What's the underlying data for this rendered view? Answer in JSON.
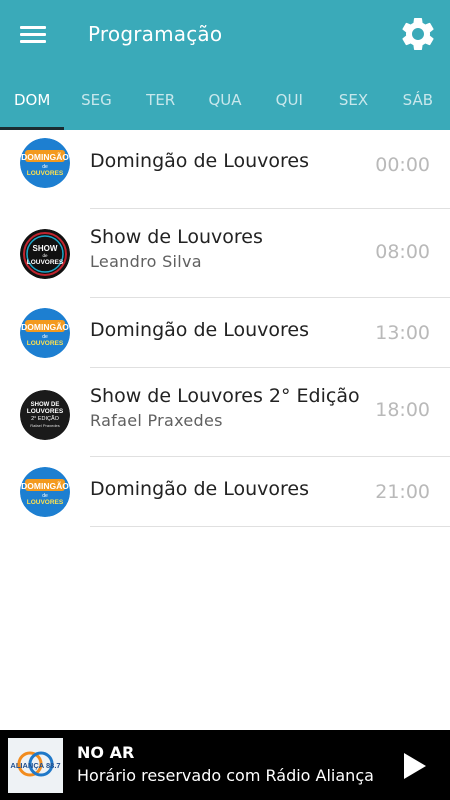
{
  "header": {
    "title": "Programação",
    "menu_icon": "hamburger-menu-icon",
    "settings_icon": "gear-icon",
    "bg_color": "#3aaab9"
  },
  "tabs": [
    {
      "label": "DOM",
      "active": true
    },
    {
      "label": "SEG",
      "active": false
    },
    {
      "label": "TER",
      "active": false
    },
    {
      "label": "QUA",
      "active": false
    },
    {
      "label": "QUI",
      "active": false
    },
    {
      "label": "SEX",
      "active": false
    },
    {
      "label": "SÁB",
      "active": false
    }
  ],
  "schedule": [
    {
      "title": "Domingão de Louvores",
      "host": "",
      "time": "00:00",
      "logo": "domingao-logo",
      "logo_lines": [
        "DOMINGÃO",
        "de",
        "LOUVORES"
      ]
    },
    {
      "title": "Show de Louvores",
      "host": "Leandro Silva",
      "time": "08:00",
      "logo": "show-logo",
      "logo_lines": [
        "SHOW",
        "de",
        "LOUVORES"
      ]
    },
    {
      "title": "Domingão de Louvores",
      "host": "",
      "time": "13:00",
      "logo": "domingao-logo",
      "logo_lines": [
        "DOMINGÃO",
        "de",
        "LOUVORES"
      ]
    },
    {
      "title": "Show de Louvores 2° Edição",
      "host": "Rafael Praxedes",
      "time": "18:00",
      "logo": "show2-logo",
      "logo_lines": [
        "SHOW DE",
        "LOUVORES",
        "2° EDIÇÃO",
        "Rafael Praxedes"
      ]
    },
    {
      "title": "Domingão de Louvores",
      "host": "",
      "time": "21:00",
      "logo": "domingao-logo",
      "logo_lines": [
        "DOMINGÃO",
        "de",
        "LOUVORES"
      ]
    }
  ],
  "player": {
    "label": "NO AR",
    "description": "Horário reservado com Rádio Aliança",
    "logo_text": "ALIANÇA 88.7",
    "play_icon": "play-icon"
  }
}
